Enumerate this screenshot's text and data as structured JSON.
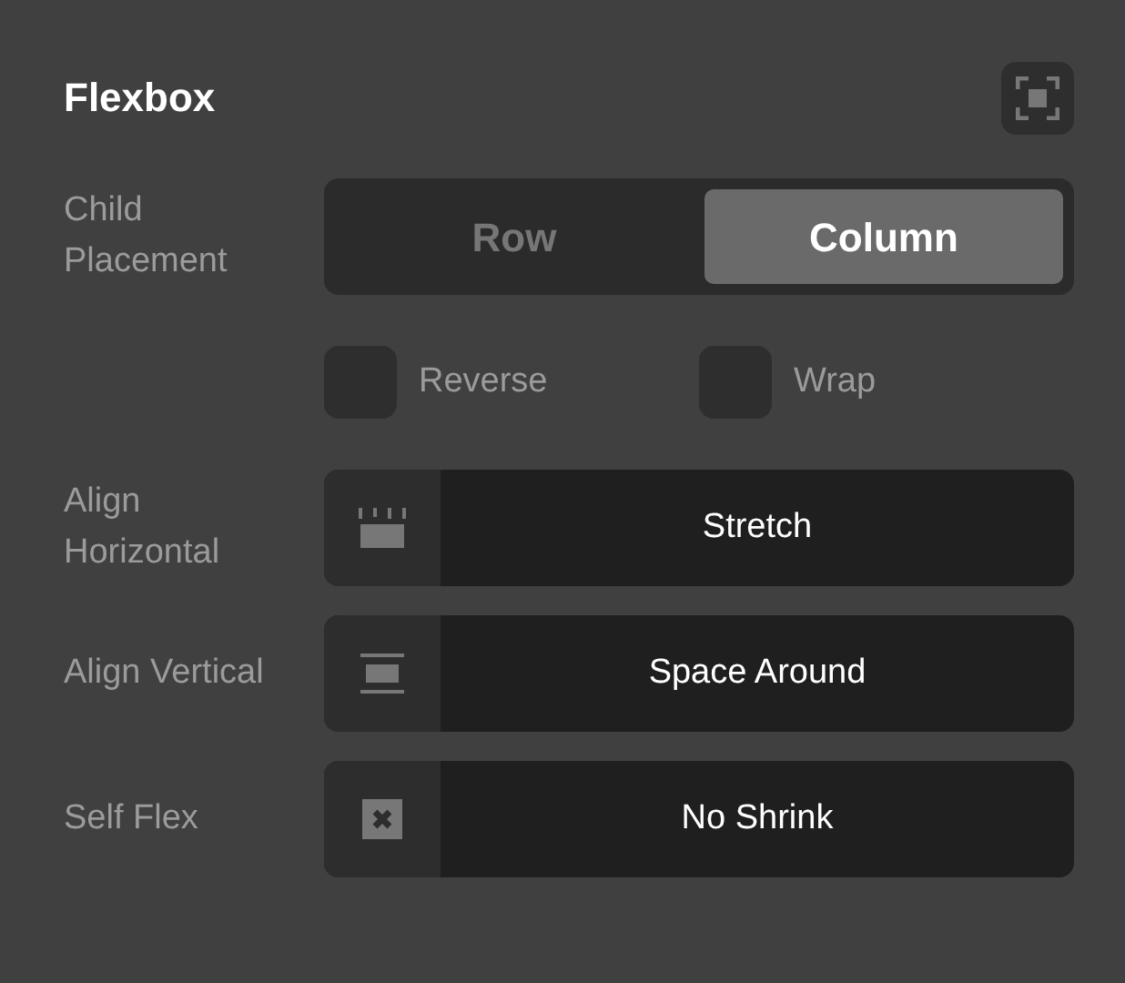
{
  "panel": {
    "title": "Flexbox"
  },
  "child_placement": {
    "label": "Child Placement",
    "options": [
      {
        "label": "Row",
        "selected": false
      },
      {
        "label": "Column",
        "selected": true
      }
    ]
  },
  "checkboxes": [
    {
      "label": "Reverse",
      "checked": false
    },
    {
      "label": "Wrap",
      "checked": false
    }
  ],
  "selects": [
    {
      "kind": "stretch",
      "label": "Align Horizontal",
      "value": "Stretch"
    },
    {
      "kind": "space-around",
      "label": "Align Vertical",
      "value": "Space Around"
    },
    {
      "kind": "no-shrink",
      "label": "Self Flex",
      "value": "No Shrink"
    }
  ]
}
